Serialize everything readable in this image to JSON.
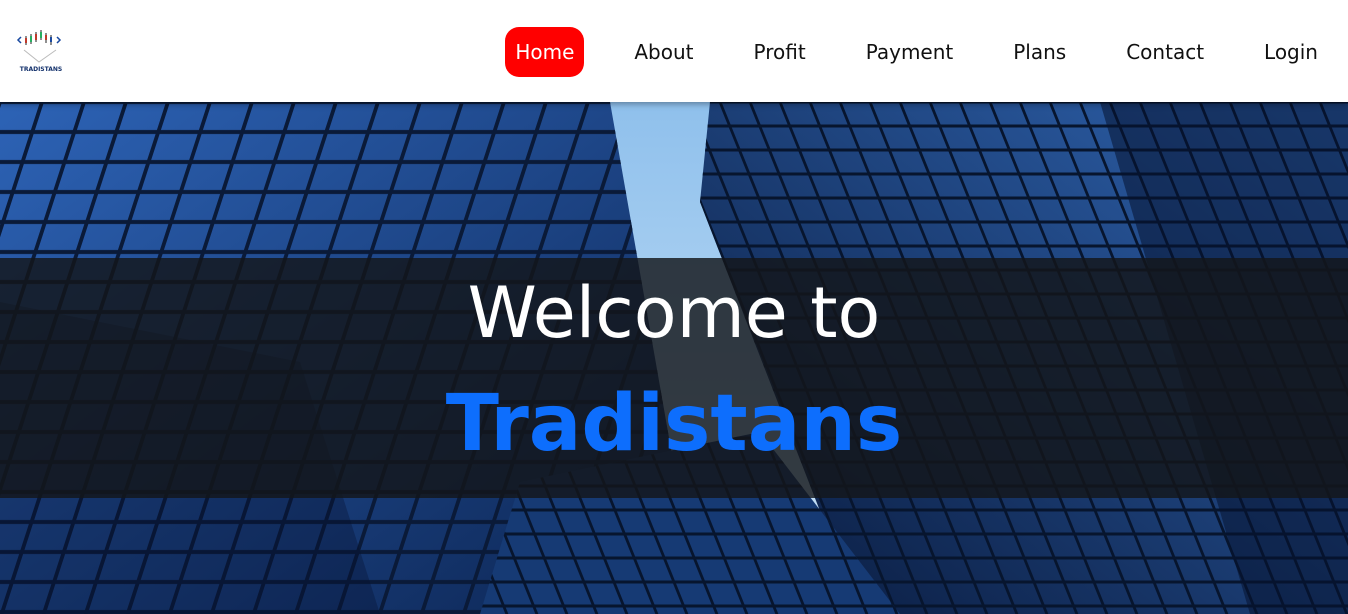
{
  "logo": {
    "text": "TRADISTANS",
    "icon": "candlestick-chart-logo"
  },
  "nav": {
    "items": [
      {
        "label": "Home",
        "active": true
      },
      {
        "label": "About",
        "active": false
      },
      {
        "label": "Profit",
        "active": false
      },
      {
        "label": "Payment",
        "active": false
      },
      {
        "label": "Plans",
        "active": false
      },
      {
        "label": "Contact",
        "active": false
      },
      {
        "label": "Login",
        "active": false
      }
    ]
  },
  "hero": {
    "welcome": "Welcome to",
    "brand": "Tradistans",
    "background": "skyscrapers-photo"
  },
  "colors": {
    "active_nav": "#ff0000",
    "brand": "#0d6efd",
    "overlay": "#14161a"
  }
}
